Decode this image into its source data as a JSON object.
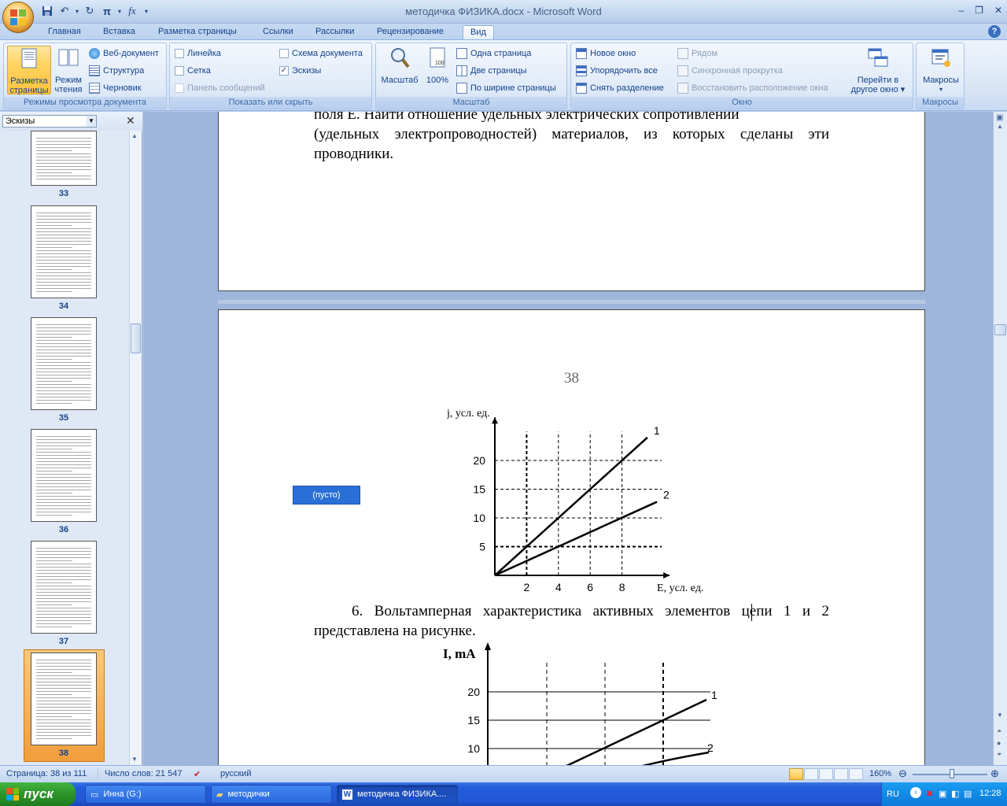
{
  "window": {
    "title": "методичка ФИЗИКА.docx - Microsoft Word"
  },
  "tabs": [
    "Главная",
    "Вставка",
    "Разметка страницы",
    "Ссылки",
    "Рассылки",
    "Рецензирование",
    "Вид"
  ],
  "active_tab": "Вид",
  "ribbon": {
    "views": {
      "label": "Режимы просмотра документа",
      "print_layout": "Разметка\nстраницы",
      "print_layout_l1": "Разметка",
      "print_layout_l2": "страницы",
      "reading_l1": "Режим",
      "reading_l2": "чтения",
      "web": "Веб-документ",
      "outline": "Структура",
      "draft": "Черновик"
    },
    "show": {
      "label": "Показать или скрыть",
      "ruler": "Линейка",
      "grid": "Сетка",
      "message_bar": "Панель сообщений",
      "doc_map": "Схема документа",
      "thumbnails": "Эскизы"
    },
    "zoom": {
      "label": "Масштаб",
      "zoom": "Масштаб",
      "hundred": "100%",
      "one_page": "Одна страница",
      "two_pages": "Две страницы",
      "page_width": "По ширине страницы"
    },
    "window": {
      "label": "Окно",
      "new_window": "Новое окно",
      "arrange_all": "Упорядочить все",
      "split": "Снять разделение",
      "side_by_side": "Рядом",
      "sync_scroll": "Синхронная прокрутка",
      "reset_pos": "Восстановить расположение окна",
      "switch_l1": "Перейти в",
      "switch_l2": "другое окно ▾"
    },
    "macros": {
      "label": "Макросы",
      "macros": "Макросы"
    }
  },
  "thumb_pane": {
    "selector": "Эскизы",
    "pages": [
      "33",
      "34",
      "35",
      "36",
      "37",
      "38"
    ],
    "selected": "38"
  },
  "document": {
    "top_text_line1": "поля E. Найти отношение удельных электрических сопротивлений",
    "top_text_line2": "(удельных электропроводностей) материалов, из которых сделаны эти",
    "top_text_line3": "проводники.",
    "page_number": "38",
    "empty_field": "(пусто)",
    "question_line1": "6. Вольтамперная характеристика активных элементов цепи 1 и 2",
    "question_line2": "представлена на рисунке."
  },
  "chart_data": [
    {
      "type": "line",
      "ylabel": "j, усл. ед.",
      "xlabel": "E, усл. ед.",
      "x_ticks": [
        "2",
        "4",
        "6",
        "8"
      ],
      "y_ticks": [
        "5",
        "10",
        "15",
        "20"
      ],
      "xlim": [
        0,
        10.5
      ],
      "ylim": [
        0,
        25
      ],
      "grid": true,
      "series": [
        {
          "name": "1",
          "x": [
            0,
            9.6
          ],
          "y": [
            0,
            24
          ]
        },
        {
          "name": "2",
          "x": [
            0,
            10.2
          ],
          "y": [
            0,
            12.8
          ]
        }
      ]
    },
    {
      "type": "line",
      "ylabel": "I, mA",
      "y_ticks": [
        "10",
        "15",
        "20"
      ],
      "grid": true,
      "series": [
        {
          "name": "1"
        },
        {
          "name": "2"
        }
      ]
    }
  ],
  "statusbar": {
    "page": "Страница: 38 из 111",
    "words": "Число слов: 21 547",
    "language": "русский",
    "zoom": "160%"
  },
  "taskbar": {
    "start": "пуск",
    "tasks": [
      "Инна (G:)",
      "методички",
      "методичка ФИЗИКА...."
    ],
    "lang": "RU",
    "clock": "12:28"
  }
}
